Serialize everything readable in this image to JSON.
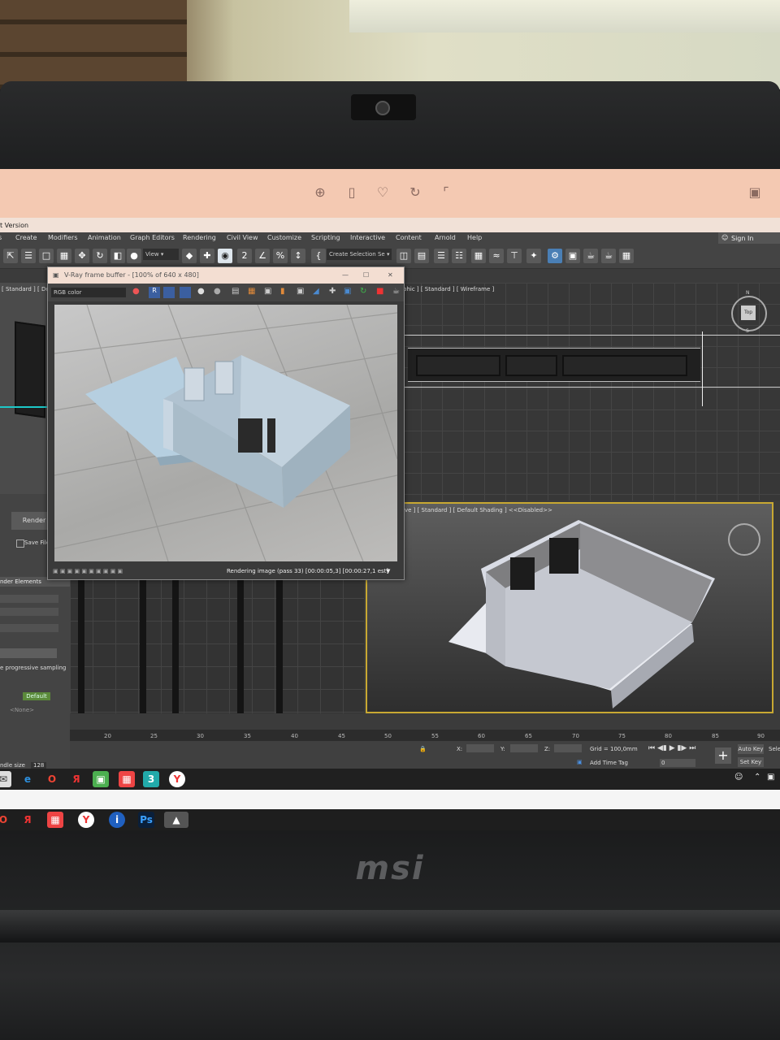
{
  "photo_viewer": {
    "icons": [
      "zoom-icon",
      "trash-icon",
      "heart-icon",
      "rotate-icon",
      "crop-icon",
      "screen-icon"
    ]
  },
  "app": {
    "title_fragment": "t Version",
    "sign_in": "Sign In",
    "menu": [
      "s",
      "Create",
      "Modifiers",
      "Animation",
      "Graph Editors",
      "Rendering",
      "Civil View",
      "Customize",
      "Scripting",
      "Interactive",
      "Content",
      "Arnold",
      "Help"
    ],
    "view_dropdown": "View",
    "selection_set": "Create Selection Se",
    "toolbar_text_2": "2",
    "toolbar_text_pct": "%"
  },
  "viewports": {
    "left_label": "[ Standard ] [ Defa",
    "top_right_label": "phic ] [ Standard ] [ Wireframe ]",
    "persp_label": "ive ] [ Standard ] [ Default Shading ]  <<Disabled>>"
  },
  "left_panel": {
    "render_button": "Render",
    "save_file": "Save File",
    "render_elements": "nder Elements",
    "progressive": "e progressive sampling",
    "default_badge": "Default",
    "none": "<None>",
    "bundle_size": "ndle size",
    "bundle_value": "128"
  },
  "timeline": {
    "ticks": [
      "20",
      "25",
      "30",
      "35",
      "40",
      "45",
      "50",
      "55",
      "60",
      "65",
      "70",
      "75",
      "80",
      "85",
      "90"
    ]
  },
  "status": {
    "x_label": "X:",
    "y_label": "Y:",
    "z_label": "Z:",
    "grid": "Grid = 100,0mm",
    "add_time_tag": "Add Time Tag",
    "auto_key": "Auto Key",
    "set_key": "Set Key",
    "sele": "Sele",
    "frame": "0"
  },
  "vfb": {
    "title": "V-Ray frame buffer - [100% of 640 x 480]",
    "channel": "RGB color",
    "status": "Rendering image (pass 33) [00:00:05,3] [00:00:27,1 est]"
  },
  "viewcube": {
    "n": "N",
    "s": "S",
    "face": "Top"
  },
  "laptop": {
    "logo": "msi"
  },
  "taskbar": {
    "icons": [
      "mail-icon",
      "edge-icon",
      "opera-icon",
      "yandex-icon",
      "package-icon",
      "office-icon",
      "3dsmax-icon",
      "yandex-browser-icon"
    ],
    "tray": [
      "people-icon",
      "chevron-up-icon",
      "network-icon"
    ]
  },
  "taskbar2": {
    "icons": [
      "opera-icon",
      "yandex-icon",
      "office-icon",
      "yandex-browser-icon",
      "info-icon",
      "photoshop-icon",
      "photos-icon"
    ]
  },
  "colors": {
    "photo_bar": "#f4c9b2",
    "max_ui": "#444444",
    "active_viewport": "#c8a832"
  }
}
